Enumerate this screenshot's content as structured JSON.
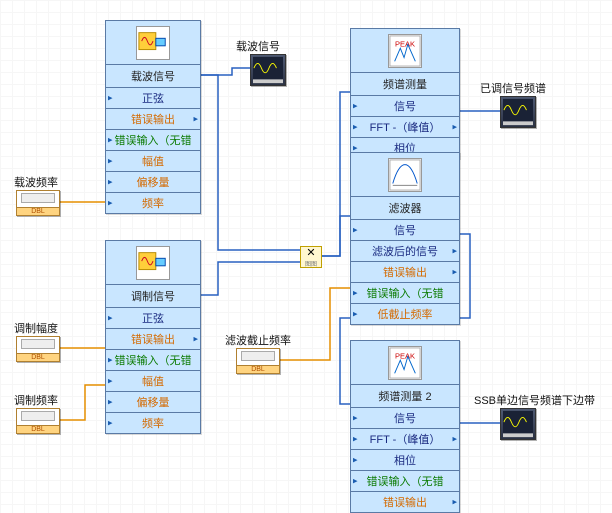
{
  "controls": {
    "carrier_freq": {
      "label": "载波频率",
      "dtype": "DBL"
    },
    "mod_amplitude": {
      "label": "调制幅度",
      "dtype": "DBL"
    },
    "mod_freq": {
      "label": "调制频率",
      "dtype": "DBL"
    },
    "cutoff_freq": {
      "label": "滤波截止频率",
      "dtype": "DBL"
    }
  },
  "indicators": {
    "carrier_signal": {
      "label": "载波信号"
    },
    "mod_spectrum": {
      "label": "已调信号频谱"
    },
    "ssb_spectrum": {
      "label": "SSB单边信号频谱下边带"
    }
  },
  "blocks": {
    "carrier": {
      "title": "载波信号",
      "rows": [
        {
          "text": "正弦",
          "cls": "",
          "lcaret": true
        },
        {
          "text": "错误输出",
          "cls": "orange",
          "rcaret": true
        },
        {
          "text": "错误输入（无错",
          "cls": "green",
          "lcaret": true
        },
        {
          "text": "幅值",
          "cls": "orange",
          "lcaret": true
        },
        {
          "text": "偏移量",
          "cls": "orange",
          "lcaret": true
        },
        {
          "text": "频率",
          "cls": "orange",
          "lcaret": true
        }
      ]
    },
    "mod": {
      "title": "调制信号",
      "rows": [
        {
          "text": "正弦",
          "cls": "",
          "lcaret": true
        },
        {
          "text": "错误输出",
          "cls": "orange",
          "rcaret": true
        },
        {
          "text": "错误输入（无错",
          "cls": "green",
          "lcaret": true
        },
        {
          "text": "幅值",
          "cls": "orange",
          "lcaret": true
        },
        {
          "text": "偏移量",
          "cls": "orange",
          "lcaret": true
        },
        {
          "text": "频率",
          "cls": "orange",
          "lcaret": true
        }
      ]
    },
    "spec1": {
      "title": "频谱测量",
      "rows": [
        {
          "text": "信号",
          "cls": "",
          "lcaret": true
        },
        {
          "text": "FFT -（峰值）",
          "cls": "",
          "lcaret": true,
          "rcaret": true
        },
        {
          "text": "相位",
          "cls": "",
          "lcaret": true
        }
      ]
    },
    "filter": {
      "title": "滤波器",
      "rows": [
        {
          "text": "信号",
          "cls": "",
          "lcaret": true
        },
        {
          "text": "滤波后的信号",
          "cls": "",
          "rcaret": true
        },
        {
          "text": "错误输出",
          "cls": "orange",
          "rcaret": true
        },
        {
          "text": "错误输入（无错",
          "cls": "green",
          "lcaret": true
        },
        {
          "text": "低截止频率",
          "cls": "orange",
          "lcaret": true
        }
      ]
    },
    "spec2": {
      "title": "频谱测量 2",
      "rows": [
        {
          "text": "信号",
          "cls": "",
          "lcaret": true
        },
        {
          "text": "FFT -（峰值）",
          "cls": "",
          "lcaret": true,
          "rcaret": true
        },
        {
          "text": "相位",
          "cls": "",
          "lcaret": true
        },
        {
          "text": "错误输入（无错",
          "cls": "green",
          "lcaret": true
        },
        {
          "text": "错误输出",
          "cls": "orange",
          "rcaret": true
        }
      ]
    }
  },
  "mult": {
    "symbol": "✕",
    "sub": "图图"
  },
  "icons": {
    "signalgen": "signalgen-icon",
    "peak": "peak-icon",
    "filter": "filter-icon"
  }
}
